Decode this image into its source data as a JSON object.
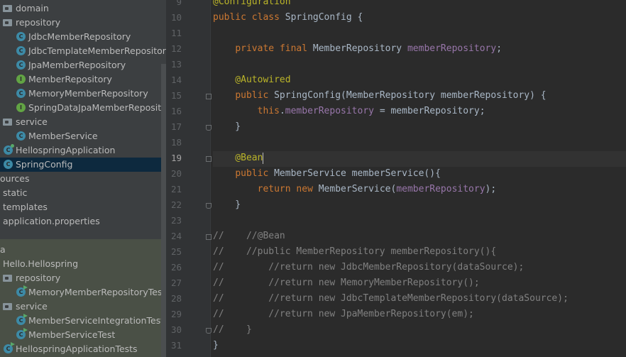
{
  "project_tree": {
    "items": [
      {
        "label": "domain",
        "icon": "folder-icon"
      },
      {
        "label": "repository",
        "icon": "folder-icon"
      },
      {
        "label": "JdbcMemberRepository",
        "icon": "class-icon",
        "badge": "C"
      },
      {
        "label": "JdbcTemplateMemberRepository",
        "icon": "class-icon",
        "badge": "C"
      },
      {
        "label": "JpaMemberRepository",
        "icon": "class-icon",
        "badge": "C"
      },
      {
        "label": "MemberRepository",
        "icon": "interface-icon",
        "badge": "I"
      },
      {
        "label": "MemoryMemberRepository",
        "icon": "class-icon",
        "badge": "C"
      },
      {
        "label": "SpringDataJpaMemberRepository",
        "icon": "interface-icon",
        "badge": "I"
      },
      {
        "label": "service",
        "icon": "folder-icon"
      },
      {
        "label": "MemberService",
        "icon": "class-icon",
        "badge": "C"
      },
      {
        "label": "HellospringApplication",
        "icon": "spring-app-icon",
        "badge": "C"
      },
      {
        "label": "SpringConfig",
        "icon": "class-icon",
        "badge": "C"
      },
      {
        "label": "ources",
        "icon": "none"
      },
      {
        "label": "static",
        "icon": "folder-icon"
      },
      {
        "label": "templates",
        "icon": "folder-icon"
      },
      {
        "label": "application.properties",
        "icon": "properties-icon"
      },
      {
        "label": "a",
        "icon": "none"
      },
      {
        "label": "Hello.Hellospring",
        "icon": "package-icon"
      },
      {
        "label": "repository",
        "icon": "folder-icon"
      },
      {
        "label": "MemoryMemberRepositoryTest",
        "icon": "test-class-icon",
        "badge": "C"
      },
      {
        "label": "service",
        "icon": "folder-icon"
      },
      {
        "label": "MemberServiceIntegrationTest",
        "icon": "test-class-icon",
        "badge": "C"
      },
      {
        "label": "MemberServiceTest",
        "icon": "test-class-icon",
        "badge": "C"
      },
      {
        "label": "HellospringApplicationTests",
        "icon": "test-class-icon",
        "badge": "C"
      }
    ]
  },
  "editor": {
    "current_line": "19",
    "lines": [
      {
        "num": "9",
        "code": "@Configuration"
      },
      {
        "num": "10",
        "code": "public class SpringConfig {"
      },
      {
        "num": "11",
        "code": ""
      },
      {
        "num": "12",
        "code": "    private final MemberRepository memberRepository;"
      },
      {
        "num": "13",
        "code": ""
      },
      {
        "num": "14",
        "code": "    @Autowired"
      },
      {
        "num": "15",
        "code": "    public SpringConfig(MemberRepository memberRepository) {"
      },
      {
        "num": "16",
        "code": "        this.memberRepository = memberRepository;"
      },
      {
        "num": "17",
        "code": "    }"
      },
      {
        "num": "18",
        "code": ""
      },
      {
        "num": "19",
        "code": "    @Bean"
      },
      {
        "num": "20",
        "code": "    public MemberService memberService(){"
      },
      {
        "num": "21",
        "code": "        return new MemberService(memberRepository);"
      },
      {
        "num": "22",
        "code": "    }"
      },
      {
        "num": "23",
        "code": ""
      },
      {
        "num": "24",
        "code": "//    //@Bean"
      },
      {
        "num": "25",
        "code": "//    //public MemberRepository memberRepository(){"
      },
      {
        "num": "26",
        "code": "//        //return new JdbcMemberRepository(dataSource);"
      },
      {
        "num": "27",
        "code": "//        //return new MemoryMemberRepository();"
      },
      {
        "num": "28",
        "code": "//        //return new JdbcTemplateMemberRepository(dataSource);"
      },
      {
        "num": "29",
        "code": "//        //return new JpaMemberRepository(em);"
      },
      {
        "num": "30",
        "code": "//    }"
      },
      {
        "num": "31",
        "code": "}"
      }
    ]
  }
}
